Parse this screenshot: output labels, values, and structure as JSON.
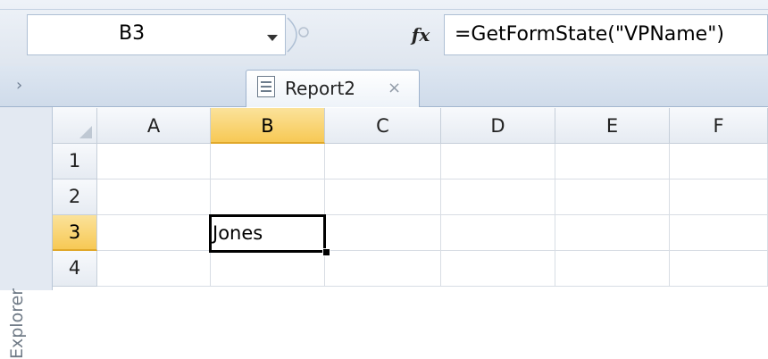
{
  "formula_bar": {
    "name_box": "B3",
    "fx_label": "fx",
    "formula": "=GetFormState(\"VPName\")"
  },
  "tabs": [
    {
      "label": "Report2",
      "close": "×"
    }
  ],
  "explorer": {
    "label": "Explorer",
    "chevron": "›"
  },
  "grid": {
    "columns": [
      "A",
      "B",
      "C",
      "D",
      "E",
      "F"
    ],
    "rows": [
      "1",
      "2",
      "3",
      "4"
    ],
    "active_column": "B",
    "active_row": "3",
    "cells": {
      "B3": "Jones"
    }
  },
  "colors": {
    "active_header": "#f7c955",
    "selection_border": "#000000"
  }
}
